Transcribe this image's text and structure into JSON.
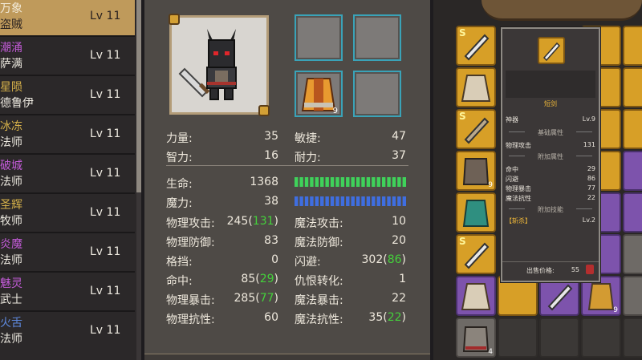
{
  "roster": [
    {
      "name": "万象",
      "cls": "盗贼",
      "lv": "Lv 11",
      "color": "#bfa3c8",
      "selected": true
    },
    {
      "name": "潮涌",
      "cls": "萨满",
      "lv": "Lv 11",
      "color": "#c35bd8"
    },
    {
      "name": "星陨",
      "cls": "德鲁伊",
      "lv": "Lv 11",
      "color": "#d7b24a"
    },
    {
      "name": "冰冻",
      "cls": "法师",
      "lv": "Lv 11",
      "color": "#d7b24a"
    },
    {
      "name": "破城",
      "cls": "法师",
      "lv": "Lv 11",
      "color": "#c35bd8"
    },
    {
      "name": "圣辉",
      "cls": "牧师",
      "lv": "Lv 11",
      "color": "#d7b24a"
    },
    {
      "name": "炎魔",
      "cls": "法师",
      "lv": "Lv 11",
      "color": "#c35bd8"
    },
    {
      "name": "魅灵",
      "cls": "武士",
      "lv": "Lv 11",
      "color": "#c35bd8"
    },
    {
      "name": "火舌",
      "cls": "法师",
      "lv": "Lv 11",
      "color": "#5f8ae0"
    }
  ],
  "equip": {
    "chest_qty": "9"
  },
  "stats": {
    "str_label": "力量:",
    "str": "35",
    "agi_label": "敏捷:",
    "agi": "47",
    "int_label": "智力:",
    "int": "16",
    "sta_label": "耐力:",
    "sta": "37",
    "hp_label": "生命:",
    "hp": "1368",
    "mp_label": "魔力:",
    "mp": "38",
    "hp_bar_fill": 1.0,
    "mp_bar_fill": 1.0,
    "patk_label": "物理攻击:",
    "patk": "245",
    "patk_bonus": "131",
    "matk_label": "魔法攻击:",
    "matk": "10",
    "pdef_label": "物理防御:",
    "pdef": "83",
    "mdef_label": "魔法防御:",
    "mdef": "20",
    "block_label": "格挡:",
    "block": "0",
    "dodge_label": "闪避:",
    "dodge": "302",
    "dodge_bonus": "86",
    "hit_label": "命中:",
    "hit": "85",
    "hit_bonus": "29",
    "threat_label": "仇恨转化:",
    "threat": "1",
    "pcrit_label": "物理暴击:",
    "pcrit": "285",
    "pcrit_bonus": "77",
    "mcrit_label": "魔法暴击:",
    "mcrit": "22",
    "pres_label": "物理抗性:",
    "pres": "60",
    "mres_label": "魔法抗性:",
    "mres": "35",
    "mres_bonus": "22"
  },
  "tooltip": {
    "title": "短剑",
    "quality": "神器",
    "level": "Lv.9",
    "base_header": "基础属性",
    "base": [
      {
        "k": "物理攻击",
        "v": "131"
      }
    ],
    "extra_header": "附加属性",
    "extra": [
      {
        "k": "命中",
        "v": "29"
      },
      {
        "k": "闪避",
        "v": "86"
      },
      {
        "k": "物理暴击",
        "v": "77"
      },
      {
        "k": "魔法抗性",
        "v": "22"
      }
    ],
    "skill_header": "附加技能",
    "skill": "【斩杀】",
    "skill_lv": "Lv.2",
    "price_label": "出售价格:",
    "price": "55"
  },
  "inventory_qty": [
    "9",
    "9",
    "9",
    "4"
  ],
  "colors": {
    "gold_cell": "#d79f27",
    "epic_cell": "#7d53ac",
    "hp_bar": "#3fd25a",
    "mp_bar": "#3f6ee0",
    "bonus": "#44d13b"
  }
}
